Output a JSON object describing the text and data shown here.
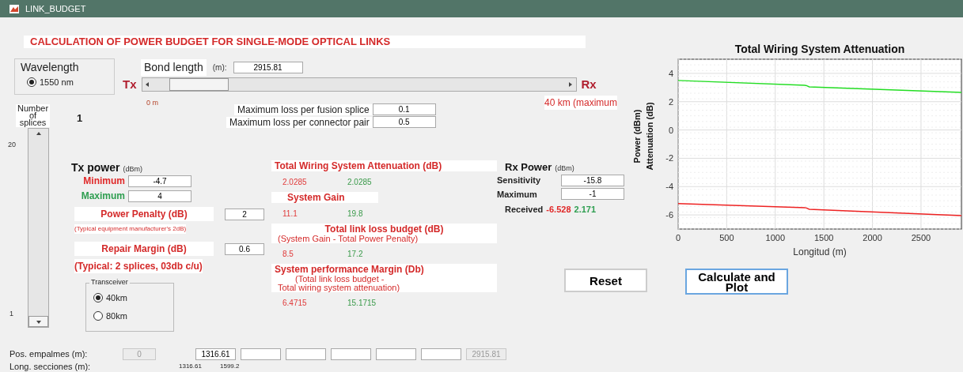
{
  "window": {
    "title": "LINK_BUDGET"
  },
  "header": "CALCULATION OF POWER BUDGET FOR SINGLE-MODE OPTICAL LINKS",
  "wavelength": {
    "title": "Wavelength",
    "options": [
      {
        "label": "1550 nm",
        "selected": true
      }
    ]
  },
  "bond_length": {
    "label": "Bond length",
    "unit": "(m):",
    "value": "2915.81",
    "tx": "Tx",
    "rx": "Rx",
    "min_label": "0 m",
    "max_label": "40 km (maximum",
    "level": 0.073
  },
  "losses": [
    {
      "label": "Maximum loss per fusion splice",
      "value": "0.1"
    },
    {
      "label": "Maximum loss per connector pair",
      "value": "0.5"
    }
  ],
  "splices": {
    "label_lines": [
      "Number",
      "of",
      "splices"
    ],
    "value": "1",
    "max": "20",
    "min": "1",
    "level": 0
  },
  "tx_power": {
    "title": "Tx power",
    "unit": "(dBm)",
    "rows": [
      {
        "label": "Minimum",
        "value": "-4.7",
        "color": "#e02828"
      },
      {
        "label": "Maximum",
        "value": "4",
        "color": "#2e9e50"
      }
    ]
  },
  "power_penalty": {
    "label": "Power Penalty (dB)",
    "value": "2",
    "note": "(Typical equipment manufacturer's 2dB)"
  },
  "repair_margin": {
    "label": "Repair Margin (dB)",
    "value": "0.6",
    "note": "(Typical: 2 splices, 03db c/u)"
  },
  "transceiver": {
    "title": "Transceiver",
    "options": [
      {
        "label": "40km",
        "selected": true
      },
      {
        "label": "80km",
        "selected": false
      }
    ]
  },
  "results": [
    {
      "title": "Total Wiring System Attenuation (dB)",
      "min": "2.0285",
      "max": "2.0285"
    },
    {
      "title": "System Gain",
      "min": "11.1",
      "max": "19.8"
    },
    {
      "title": "Total link loss budget (dB)",
      "subtitle": [
        "(System Gain - Total Power Penalty)"
      ],
      "min": "8.5",
      "max": "17.2"
    },
    {
      "title": "System performance Margin (Db)",
      "subtitle": [
        "(Total link loss budget -",
        "Total wiring system attenuation)"
      ],
      "min": "6.4715",
      "max": "15.1715"
    }
  ],
  "rx_power": {
    "title": "Rx Power",
    "unit": "(dBm)",
    "fields": [
      {
        "label": "Sensitivity",
        "value": "-15.8"
      },
      {
        "label": "Maximum",
        "value": "-1"
      }
    ],
    "received": {
      "label": "Received",
      "min": "-6.528",
      "max": "2.171"
    }
  },
  "buttons": [
    {
      "label": "Reset",
      "focused": false
    },
    {
      "label": "Calculate and Plot",
      "focused": true
    }
  ],
  "chart": {
    "chart_data": {
      "type": "line",
      "title": "Total Wiring System Attenuation",
      "xlabel": "Longitud (m)",
      "ylabel": [
        "Power (dBm)",
        "Attenuation (dB)"
      ],
      "x": [
        0,
        1316.61,
        1350,
        2915.81
      ],
      "series": [
        {
          "color": "#22dd22",
          "values": [
            3.5,
            3.15,
            3.05,
            2.65
          ]
        },
        {
          "color": "#ee2222",
          "values": [
            -5.2,
            -5.5,
            -5.6,
            -6.05
          ]
        }
      ],
      "xlim": [
        0,
        2915.81
      ],
      "ylim": [
        -7,
        5
      ],
      "xticks": [
        0,
        500,
        1000,
        1500,
        2000,
        2500
      ],
      "yticks": [
        -6,
        -4,
        -2,
        0,
        2,
        4
      ],
      "grid": true
    }
  },
  "positions": {
    "label": "Pos. empalmes (m):",
    "fields": [
      {
        "value": "0",
        "disabled": true
      },
      {
        "value": "1316.61",
        "disabled": false
      },
      {
        "disabled": false
      },
      {
        "disabled": false
      },
      {
        "disabled": false
      },
      {
        "disabled": false
      },
      {
        "disabled": false
      },
      {
        "value": "2915.81",
        "disabled": true
      }
    ]
  },
  "sections": {
    "label": "Long. secciones (m):",
    "values": [
      "1316.61",
      "1599.2"
    ]
  }
}
